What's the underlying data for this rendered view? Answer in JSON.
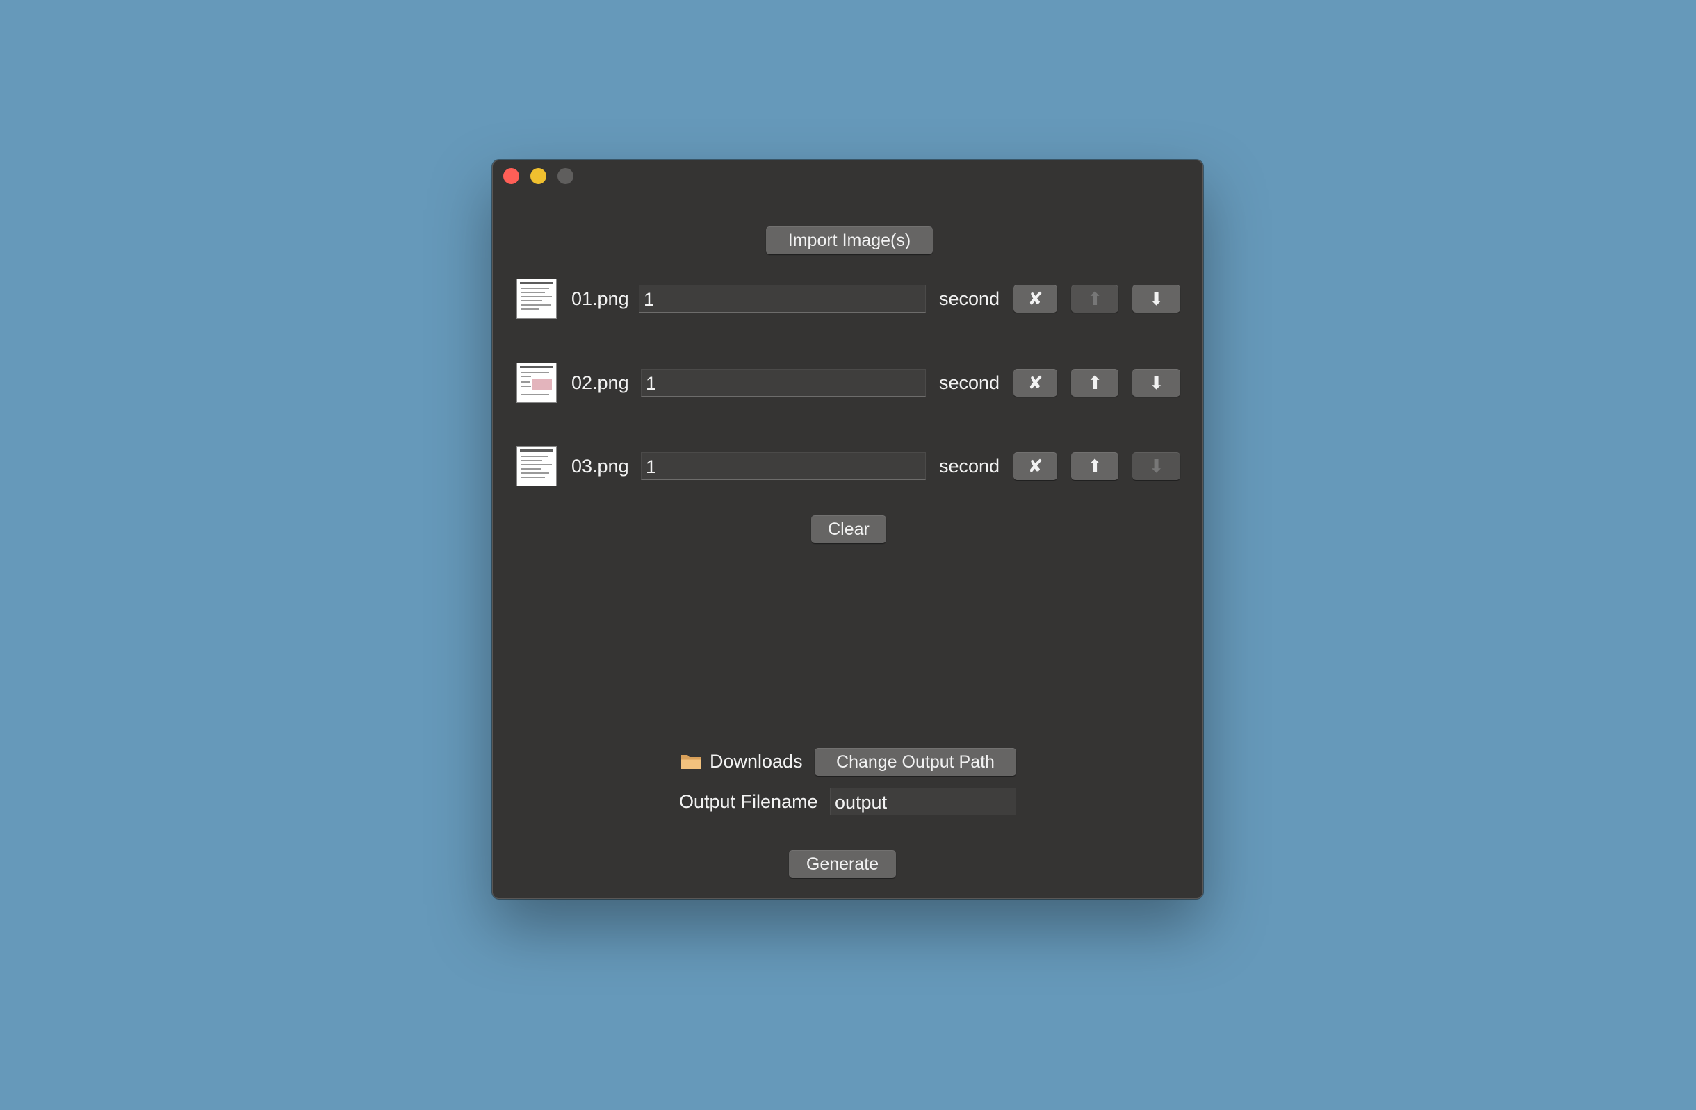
{
  "window": {
    "import_button": "Import Image(s)",
    "clear_button": "Clear",
    "generate_button": "Generate"
  },
  "images": [
    {
      "name": "01.png",
      "duration": "1",
      "unit": "second",
      "remove": "✘",
      "up": "⬆",
      "down": "⬇",
      "up_enabled": false,
      "down_enabled": true
    },
    {
      "name": "02.png",
      "duration": "1",
      "unit": "second",
      "remove": "✘",
      "up": "⬆",
      "down": "⬇",
      "up_enabled": true,
      "down_enabled": true
    },
    {
      "name": "03.png",
      "duration": "1",
      "unit": "second",
      "remove": "✘",
      "up": "⬆",
      "down": "⬇",
      "up_enabled": true,
      "down_enabled": false
    }
  ],
  "output": {
    "folder_icon": "folder-icon",
    "folder_name": "Downloads",
    "change_path_button": "Change Output Path",
    "filename_label": "Output Filename",
    "filename_value": "output"
  },
  "colors": {
    "background": "#6699BA",
    "window": "#353433",
    "button": "#666564",
    "close": "#FF5F57",
    "minimize": "#F0C02F",
    "maximize": "#5F5E5D"
  }
}
